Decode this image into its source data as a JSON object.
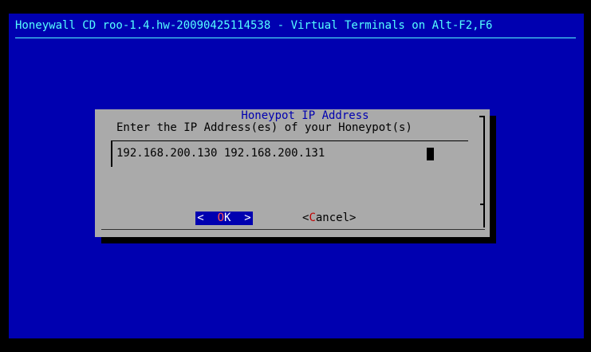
{
  "backtitle": "Honeywall CD roo-1.4.hw-20090425114538 - Virtual Terminals on Alt-F2,F6",
  "dialog": {
    "title": "Honeypot IP Address",
    "prompt": "Enter the IP Address(es) of your Honeypot(s)",
    "input_value": "192.168.200.130 192.168.200.131"
  },
  "buttons": {
    "ok": {
      "left": "<  ",
      "hotkey": "O",
      "rest": "K",
      "right": "  >"
    },
    "cancel": {
      "left": "<",
      "hotkey": "C",
      "rest": "ancel>"
    }
  },
  "colors": {
    "background": "#0000B0",
    "backtitle": "#55FFFF",
    "dialog": "#AAAAAA",
    "title": "#0000B0",
    "hotkey": "#FF5555"
  }
}
